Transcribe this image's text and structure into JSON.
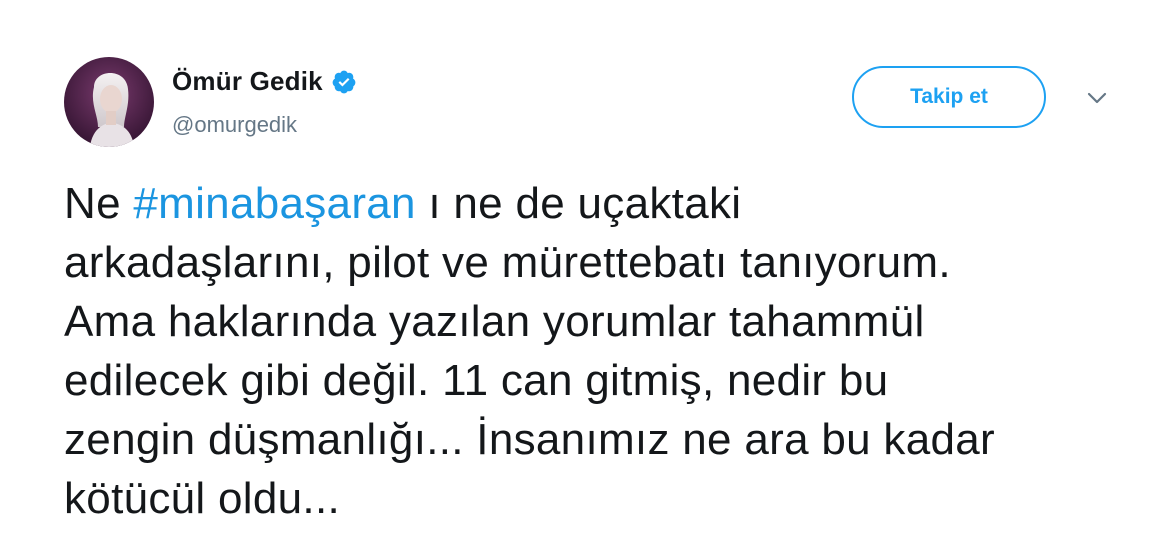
{
  "author": {
    "display_name": "Ömür Gedik",
    "handle": "@omurgedik",
    "verified": true,
    "avatar_icon": "user-avatar"
  },
  "actions": {
    "follow_label": "Takip et",
    "more_icon": "chevron-down-icon"
  },
  "tweet": {
    "line1_before": "Ne ",
    "hashtag": "#minabaşaran",
    "line1_after": " ı ne de uçaktaki",
    "lines": [
      "arkadaşlarını, pilot ve mürettebatı tanıyorum.",
      "Ama haklarında yazılan yorumlar tahammül",
      "edilecek gibi değil. 11 can gitmiş, nedir bu",
      "zengin düşmanlığı... İnsanımız ne ara bu kadar",
      "kötücül oldu..."
    ]
  },
  "colors": {
    "accent": "#1da1f2",
    "hashtag": "#1b95e0",
    "text": "#14171a",
    "secondary_text": "#657786"
  }
}
